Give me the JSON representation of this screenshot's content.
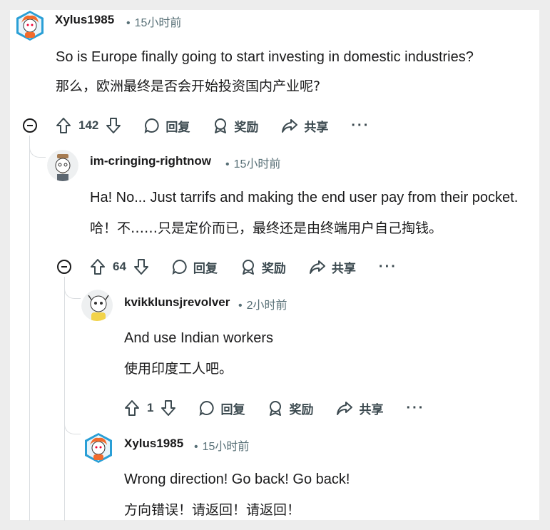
{
  "comments": [
    {
      "username": "Xylus1985",
      "time": "15小时前",
      "text_en": "So is Europe finally going to start investing in domestic industries?",
      "text_zh": "那么，欧洲最终是否会开始投资国内产业呢?",
      "votes": "142",
      "reply": "回复",
      "award": "奖励",
      "share": "共享"
    },
    {
      "username": "im-cringing-rightnow",
      "time": "15小时前",
      "text_en": "Ha! No... Just tarrifs and making the end user pay from their pocket.",
      "text_zh": "哈！不……只是定价而已，最终还是由终端用户自己掏钱。",
      "votes": "64",
      "reply": "回复",
      "award": "奖励",
      "share": "共享"
    },
    {
      "username": "kvikklunsjrevolver",
      "time": "2小时前",
      "text_en": "And use Indian workers",
      "text_zh": "使用印度工人吧。",
      "votes": "1",
      "reply": "回复",
      "award": "奖励",
      "share": "共享"
    },
    {
      "username": "Xylus1985",
      "time": "15小时前",
      "text_en": "Wrong direction! Go back! Go back!",
      "text_zh": "方向错误！请返回！请返回！"
    }
  ],
  "dot": "•",
  "more": "···",
  "colors": {
    "text": "#1a1a1b",
    "meta": "#576f76",
    "action": "#3c4a50",
    "thread": "#dadde0"
  }
}
